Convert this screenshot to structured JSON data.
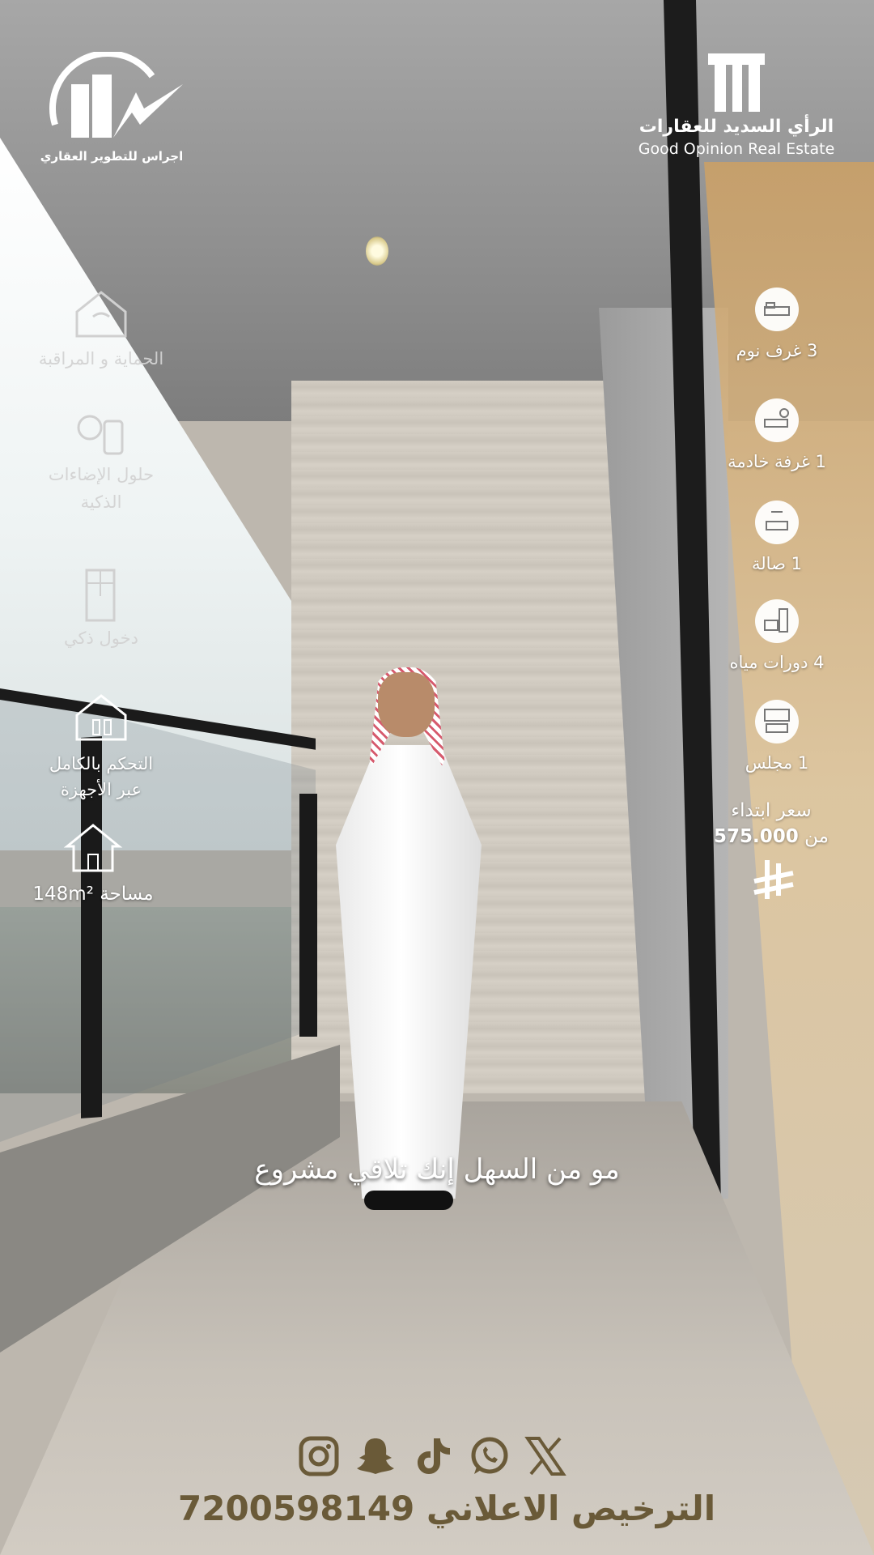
{
  "branding": {
    "left_logo_text": "اجراس للتطوير العقاري",
    "right_logo_ar": "الرأي السديد للعقارات",
    "right_logo_en": "Good Opinion Real Estate"
  },
  "unit_features": [
    {
      "count": "3",
      "label": "غرف نوم",
      "icon": "bed-icon"
    },
    {
      "count": "1",
      "label": "غرفة خادمة",
      "icon": "maid-room-icon"
    },
    {
      "count": "1",
      "label": "صالة",
      "icon": "living-room-icon"
    },
    {
      "count": "4",
      "label": "دورات مياه",
      "icon": "bathroom-icon"
    },
    {
      "count": "1",
      "label": "مجلس",
      "icon": "majlis-icon"
    }
  ],
  "smart_features": [
    {
      "label": "الحماية و المراقبة",
      "icon": "security-home-icon"
    },
    {
      "label_line1": "حلول الإضاءات",
      "label_line2": "الذكية",
      "icon": "smart-lighting-icon"
    },
    {
      "label": "دخول ذكي",
      "icon": "smart-entry-icon"
    },
    {
      "label_line1": "التحكم بالكامل",
      "label_line2": "عبر الأجهزة",
      "icon": "smart-control-icon"
    }
  ],
  "area": {
    "label": "مساحة",
    "value": "148",
    "unit": "m²",
    "icon": "house-icon"
  },
  "price": {
    "label_line1": "سعر ابتداء",
    "prefix": "من",
    "value": "575.000",
    "currency_icon": "saudi-riyal-icon"
  },
  "caption": "مو من السهل إنك تلاقي مشروع",
  "social_icons": [
    "instagram-icon",
    "snapchat-icon",
    "tiktok-icon",
    "whatsapp-icon",
    "x-icon"
  ],
  "license": {
    "label": "الترخيص الاعلاني",
    "number": "7200598149"
  },
  "colors": {
    "overlay_text": "#ffffff",
    "license_text": "#6a5a38"
  }
}
